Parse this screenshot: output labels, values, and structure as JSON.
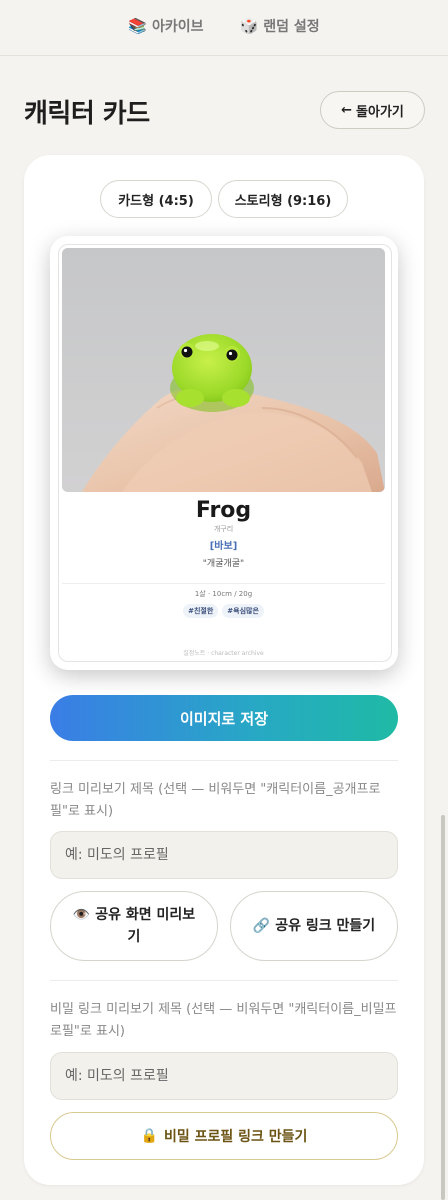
{
  "nav": {
    "archive_label": "아카이브",
    "random_label": "랜덤 설정"
  },
  "header": {
    "title": "캐릭터 카드",
    "back_label": "돌아가기"
  },
  "format": {
    "card_label": "카드형 (4:5)",
    "story_label": "스토리형 (9:16)"
  },
  "card": {
    "name": "Frog",
    "subname": "개구리",
    "tag": "[바보]",
    "quote": "\"개굴개굴\"",
    "stats": "1살 · 10cm / 20g",
    "hashtags": [
      "#친절한",
      "#욕심많은"
    ],
    "watermark": "설정노트 · character archive"
  },
  "actions": {
    "save_label": "이미지로 저장"
  },
  "public_link": {
    "label": "링크 미리보기 제목 (선택 — 비워두면 \"캐릭터이름_공개프로필\"로 표시)",
    "placeholder": "예: 미도의 프로필",
    "preview_label": "👁️ 공유 화면 미리보기",
    "create_label": "🔗 공유 링크 만들기"
  },
  "secret_link": {
    "label": "비밀 링크 미리보기 제목 (선택 — 비워두면 \"캐릭터이름_비밀프로필\"로 표시)",
    "placeholder": "예: 미도의 프로필",
    "create_label": "비밀 프로필 링크 만들기"
  },
  "colors": {
    "accent_start": "#3a7de6",
    "accent_end": "#1fbaa5",
    "frog_green": "#a6e22a",
    "secret_border": "#d8c98f"
  }
}
